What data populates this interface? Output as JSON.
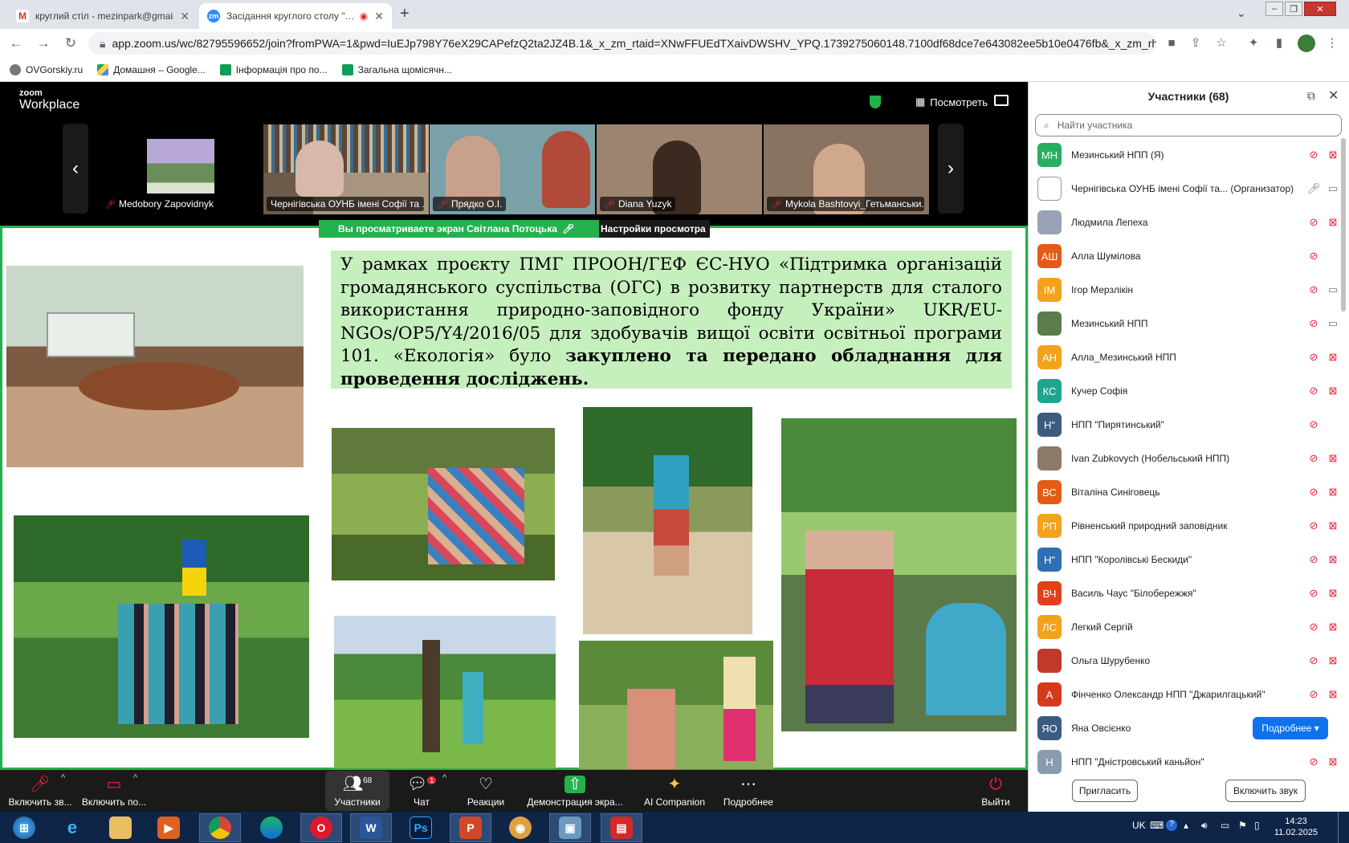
{
  "browser": {
    "tabs": [
      {
        "title": "круглий стіл - mezinpark@gmail",
        "active": false
      },
      {
        "title": "Засідання круглого столу \"…",
        "active": true
      }
    ],
    "new_tab": "+",
    "url": "app.zoom.us/wc/82795596652/join?fromPWA=1&pwd=IuEJp798Y76eX29CAPefzQ2ta2JZ4B.1&_x_zm_rtaid=XNwFFUEdTXaivDWSHV_YPQ.1739275060148.7100df68dce7e643082ee5b10e0476fb&_x_zm_rhtaid...",
    "bookmarks": [
      "OVGorskiy.ru",
      "Домашня – Google...",
      "Інформація про по...",
      "Загальна щомісячн..."
    ]
  },
  "zoom": {
    "logo_small": "zoom",
    "logo_big": "Workplace",
    "view_label": "Посмотреть",
    "thumbnails": [
      {
        "name": "Medobory Zapovidnyk",
        "muted": true
      },
      {
        "name": "Чернігівська ОУНБ імені Софії та ...",
        "muted": false
      },
      {
        "name": "Прядко О.І.",
        "muted": true
      },
      {
        "name": "Diana Yuzyk",
        "muted": true
      },
      {
        "name": "Mykola Bashtovyi_Гетьманськи...",
        "muted": true
      }
    ],
    "share_banner": "Вы просматриваете экран  Світлана Потоцька",
    "view_settings": "Настройки просмотра",
    "slide_text_normal": "У рамках проєкту ПМГ ПРООН/ГЕФ ЄС-НУО «Підтримка організацій громадянського суспільства (ОГС) в розвитку партнерств для сталого використання природно-заповідного фонду України» UKR/EU-NGOs/OP5/Y4/2016/05 для здобувачів вищої освіти освітньої програми 101. «Екологія» було ",
    "slide_text_bold": "закуплено та передано обладнання для проведення досліджень.",
    "toolbar": {
      "mic": "Включить зв...",
      "video": "Включить по...",
      "participants": "Участники",
      "participants_count": "68",
      "chat": "Чат",
      "chat_badge": "1",
      "reactions": "Реакции",
      "share": "Демонстрация экра...",
      "ai": "AI Companion",
      "more": "Подробнее",
      "leave": "Выйти"
    }
  },
  "panel": {
    "title": "Участники (68)",
    "search_placeholder": "Найти участника",
    "participants": [
      {
        "initials": "МН",
        "name": "Мезинський НПП (Я)",
        "color": "#27ae60",
        "mic": "muted",
        "video": "off"
      },
      {
        "initials": "",
        "name": "Чернігівська ОУНБ імені Софії та... (Организатор)",
        "color": "#ffffff",
        "mic": "on",
        "video": "on"
      },
      {
        "initials": "",
        "name": "Людмила Лепеха",
        "color": "#9aa3b5",
        "mic": "muted",
        "video": "off"
      },
      {
        "initials": "АШ",
        "name": "Алла Шумілова",
        "color": "#e35b14",
        "mic": "muted",
        "video": ""
      },
      {
        "initials": "ІМ",
        "name": "Ігор Мерзлікін",
        "color": "#f2a31b",
        "mic": "muted",
        "video": "on"
      },
      {
        "initials": "",
        "name": "Мезинський НПП",
        "color": "#5a7d4a",
        "mic": "muted",
        "video": "on"
      },
      {
        "initials": "АН",
        "name": "Алла_Мезинський НПП",
        "color": "#f2a31b",
        "mic": "muted",
        "video": "off"
      },
      {
        "initials": "КС",
        "name": "Кучер Софія",
        "color": "#1ea58f",
        "mic": "muted",
        "video": "off"
      },
      {
        "initials": "Н\"",
        "name": "НПП \"Пирятинський\"",
        "color": "#3d5b80",
        "mic": "muted",
        "video": ""
      },
      {
        "initials": "",
        "name": "Ivan Zubkovych (Нобельський НПП)",
        "color": "#8a7a6a",
        "mic": "muted",
        "video": "off"
      },
      {
        "initials": "ВС",
        "name": "Віталіна Синіговець",
        "color": "#e35b14",
        "mic": "muted",
        "video": "off"
      },
      {
        "initials": "РП",
        "name": "Рівненський природний заповідник",
        "color": "#f2a31b",
        "mic": "muted",
        "video": "off"
      },
      {
        "initials": "Н\"",
        "name": "НПП \"Королівські Бескиди\"",
        "color": "#2f6fb3",
        "mic": "muted",
        "video": "off"
      },
      {
        "initials": "ВЧ",
        "name": "Василь Чаус \"Білобережжя\"",
        "color": "#e0401c",
        "mic": "muted",
        "video": "off"
      },
      {
        "initials": "ЛС",
        "name": "Легкий Сергій",
        "color": "#f2a31b",
        "mic": "muted",
        "video": "off"
      },
      {
        "initials": "",
        "name": "Ольга Шурубенко",
        "color": "#c0392b",
        "mic": "muted",
        "video": "off"
      },
      {
        "initials": "А",
        "name": "Фінченко Олександр НПП \"Джарилгацький\"",
        "color": "#d63a1c",
        "mic": "muted",
        "video": "off"
      },
      {
        "initials": "ЯО",
        "name": "Яна Овсієнко",
        "color": "#3d5b80",
        "mic": "",
        "video": ""
      },
      {
        "initials": "Н",
        "name": "НПП \"Дністровський каньйон\"",
        "color": "#8a9bb0",
        "mic": "muted",
        "video": "off"
      }
    ],
    "more_button": "Подробнее ▾",
    "invite_button": "Пригласить",
    "unmute_button": "Включить звук"
  },
  "taskbar": {
    "lang": "UK",
    "time": "14:23",
    "date": "11.02.2025"
  }
}
